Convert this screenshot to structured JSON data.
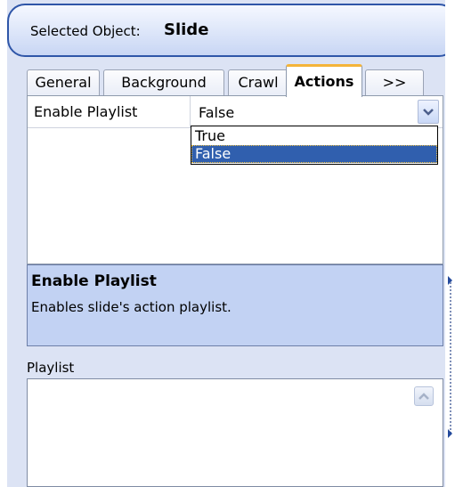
{
  "header": {
    "label": "Selected Object:",
    "value": "Slide"
  },
  "tabs": [
    {
      "label": "General"
    },
    {
      "label": "Background"
    },
    {
      "label": "Crawl"
    },
    {
      "label": "Actions",
      "active": true
    },
    {
      "label": ">>"
    }
  ],
  "property_grid": {
    "row_name": "Enable Playlist",
    "row_value": "False",
    "dropdown_options": [
      "True",
      "False"
    ],
    "dropdown_selected": "False"
  },
  "help": {
    "title": "Enable Playlist",
    "description": "Enables slide's action playlist."
  },
  "playlist": {
    "label": "Playlist"
  },
  "icons": [
    "chevron-down-icon",
    "scroll-up-arrow-icon",
    "splitter-arrow-icon"
  ],
  "colors": {
    "accent_blue": "#2f56a8",
    "panel_bg": "#dce3f4",
    "selection": "#305fae",
    "help_bg": "#c2d2f3",
    "active_tab_accent": "#f4b43a"
  }
}
